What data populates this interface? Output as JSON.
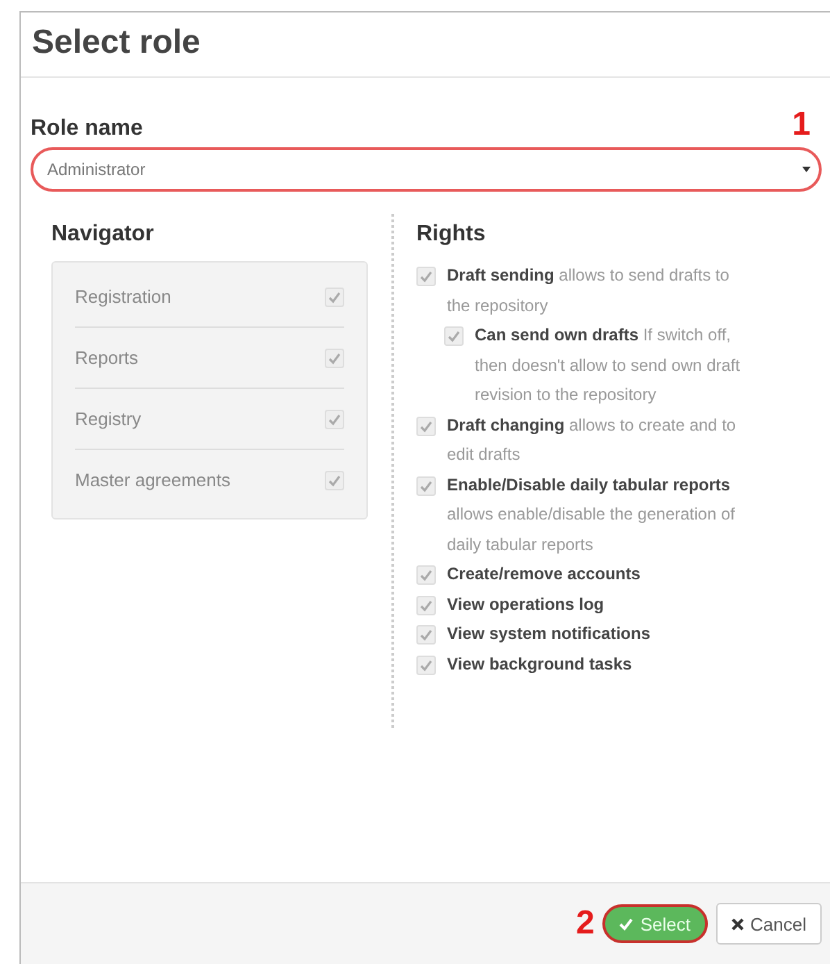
{
  "dialog": {
    "title": "Select role"
  },
  "role_field": {
    "label": "Role name",
    "value": "Administrator",
    "annotation": "1"
  },
  "navigator": {
    "title": "Navigator",
    "items": [
      {
        "label": "Registration",
        "checked": true
      },
      {
        "label": "Reports",
        "checked": true
      },
      {
        "label": "Registry",
        "checked": true
      },
      {
        "label": "Master agreements",
        "checked": true
      }
    ]
  },
  "rights": {
    "title": "Rights",
    "items": [
      {
        "name": "Draft sending",
        "description": "allows to send drafts to the repository",
        "checked": true,
        "children": [
          {
            "name": "Can send own drafts",
            "description": "If switch off, then doesn't allow to send own draft revision to the repository",
            "checked": true
          }
        ]
      },
      {
        "name": "Draft changing",
        "description": "allows to create and to edit drafts",
        "checked": true
      },
      {
        "name": "Enable/Disable daily tabular reports",
        "description": "allows enable/disable the generation of daily tabular reports",
        "checked": true
      },
      {
        "name": "Create/remove accounts",
        "checked": true
      },
      {
        "name": "View operations log",
        "checked": true
      },
      {
        "name": "View system notifications",
        "checked": true
      },
      {
        "name": "View background tasks",
        "checked": true
      }
    ]
  },
  "footer": {
    "annotation": "2",
    "buttons": [
      {
        "label": "Select",
        "kind": "primary"
      },
      {
        "label": "Cancel",
        "kind": "default"
      }
    ]
  }
}
